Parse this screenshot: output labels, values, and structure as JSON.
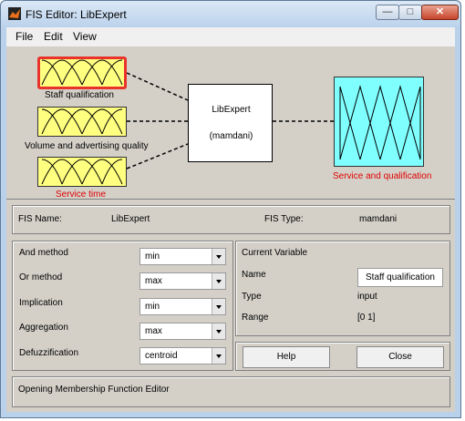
{
  "window": {
    "title": "FIS Editor: LibExpert"
  },
  "menu": [
    "File",
    "Edit",
    "View"
  ],
  "inputs": [
    {
      "label": "Staff qualification",
      "selected": true
    },
    {
      "label": "Volume and advertising quality",
      "selected": false
    },
    {
      "label": "Service time",
      "selected": false,
      "label_color": "#e00000"
    }
  ],
  "system": {
    "name": "LibExpert",
    "type": "(mamdani)"
  },
  "output": {
    "label": "Service and qualification",
    "label_color": "#e00000"
  },
  "fis_info": {
    "name_label": "FIS Name:",
    "name_value": "LibExpert",
    "type_label": "FIS Type:",
    "type_value": "mamdani"
  },
  "methods": [
    {
      "label": "And method",
      "value": "min"
    },
    {
      "label": "Or method",
      "value": "max"
    },
    {
      "label": "Implication",
      "value": "min"
    },
    {
      "label": "Aggregation",
      "value": "max"
    },
    {
      "label": "Defuzzification",
      "value": "centroid"
    }
  ],
  "current_variable": {
    "title": "Current Variable",
    "name_label": "Name",
    "name_value": "Staff qualification",
    "type_label": "Type",
    "type_value": "input",
    "range_label": "Range",
    "range_value": "[0 1]"
  },
  "buttons": {
    "help": "Help",
    "close": "Close"
  },
  "status": "Opening Membership Function Editor"
}
